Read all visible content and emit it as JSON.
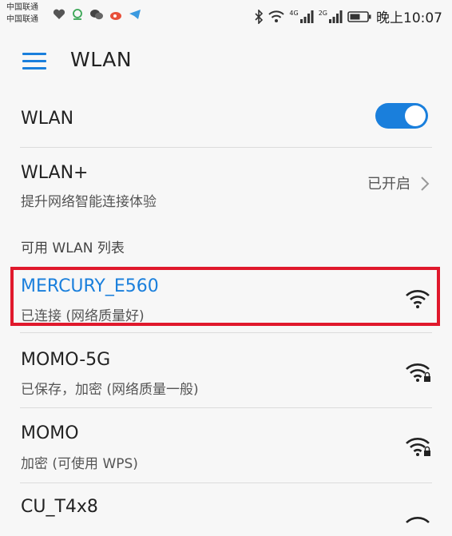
{
  "status_bar": {
    "carrier_1": "中国联通",
    "carrier_2": "中国联通",
    "network_1": "4G",
    "network_2": "2G",
    "time": "晚上10:07",
    "accent": "#1a7fdc"
  },
  "app_bar": {
    "title": "WLAN"
  },
  "wlan_row": {
    "label": "WLAN",
    "enabled": true
  },
  "wlan_plus": {
    "title": "WLAN+",
    "subtitle": "提升网络智能连接体验",
    "status": "已开启"
  },
  "section": {
    "title": "可用 WLAN 列表"
  },
  "networks": [
    {
      "name": "MERCURY_E560",
      "status": "已连接 (网络质量好)",
      "secured": false,
      "connected": true
    },
    {
      "name": "MOMO-5G",
      "status": "已保存，加密 (网络质量一般)",
      "secured": true,
      "connected": false
    },
    {
      "name": "MOMO",
      "status": "加密 (可使用 WPS)",
      "secured": true,
      "connected": false
    },
    {
      "name": "CU_T4x8",
      "status": "",
      "secured": false,
      "connected": false
    }
  ],
  "colors": {
    "highlight": "#e0192c",
    "link": "#1a7fdc"
  }
}
